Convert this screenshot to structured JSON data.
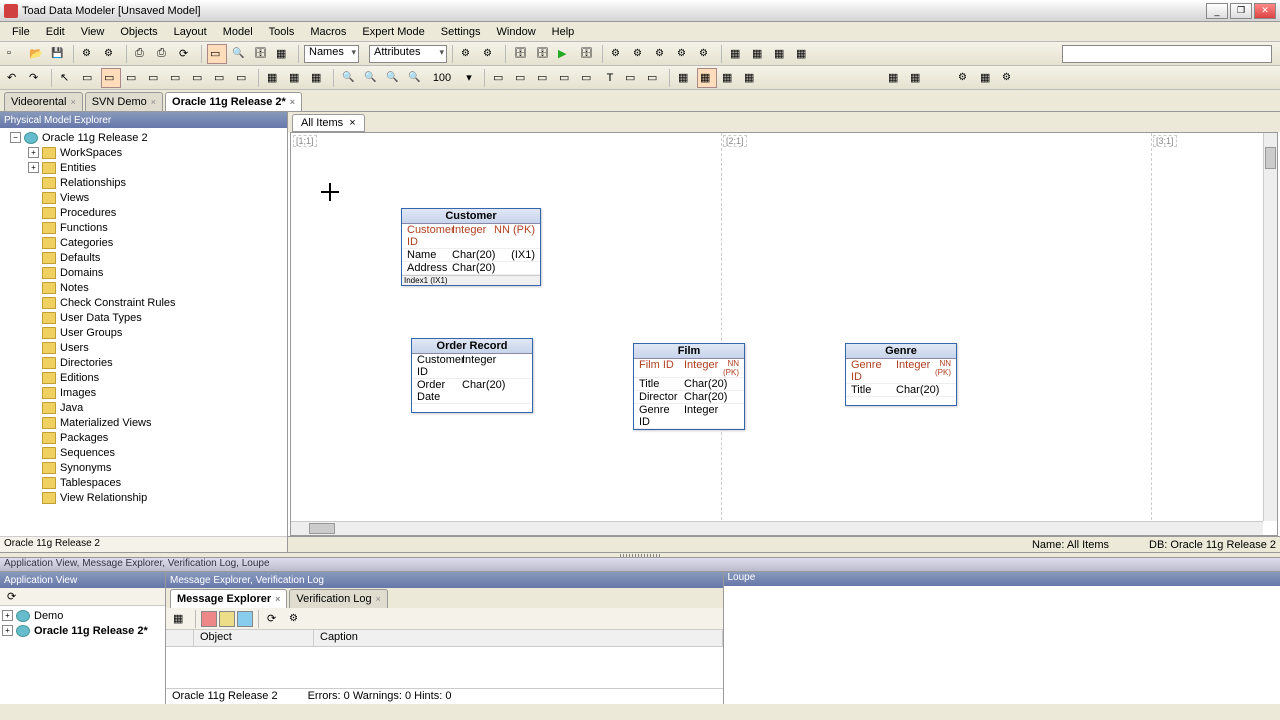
{
  "titlebar": {
    "title": "Toad Data Modeler  [Unsaved Model]"
  },
  "menu": [
    "File",
    "Edit",
    "View",
    "Objects",
    "Layout",
    "Model",
    "Tools",
    "Macros",
    "Expert Mode",
    "Settings",
    "Window",
    "Help"
  ],
  "toolbar1": {
    "combo_names": "Names",
    "combo_attrs": "Attributes"
  },
  "toolbar2": {
    "zoom": "100"
  },
  "doc_tabs": [
    {
      "label": "Videorental",
      "active": false
    },
    {
      "label": "SVN Demo",
      "active": false
    },
    {
      "label": "Oracle 11g Release 2*",
      "active": true
    }
  ],
  "explorer": {
    "header": "Physical Model Explorer",
    "root": "Oracle 11g Release 2",
    "items": [
      "WorkSpaces",
      "Entities",
      "Relationships",
      "Views",
      "Procedures",
      "Functions",
      "Categories",
      "Defaults",
      "Domains",
      "Notes",
      "Check Constraint Rules",
      "User Data Types",
      "User Groups",
      "Users",
      "Directories",
      "Editions",
      "Images",
      "Java",
      "Materialized Views",
      "Packages",
      "Sequences",
      "Synonyms",
      "Tablespaces",
      "View Relationship"
    ],
    "status": "Oracle 11g Release 2"
  },
  "canvas": {
    "tab": "All Items",
    "markers": {
      "p11": "[1;1]",
      "p21": "[2;1]",
      "p31": "[3;1]"
    },
    "status_name": "Name: All Items",
    "status_db": "DB: Oracle 11g Release 2"
  },
  "entities": {
    "customer": {
      "title": "Customer",
      "rows": [
        {
          "name": "Customer ID",
          "type": "Integer",
          "flags": "NN  (PK)",
          "key": true
        },
        {
          "name": "Name",
          "type": "Char(20)",
          "flags": "(IX1)",
          "key": false
        },
        {
          "name": "Address",
          "type": "Char(20)",
          "flags": "",
          "key": false
        }
      ],
      "footer": "Index1 (IX1)"
    },
    "order": {
      "title": "Order Record",
      "rows": [
        {
          "name": "Customer ID",
          "type": "Integer",
          "flags": "",
          "key": false
        },
        {
          "name": "Order Date",
          "type": "Char(20)",
          "flags": "",
          "key": false
        }
      ]
    },
    "film": {
      "title": "Film",
      "rows": [
        {
          "name": "Film ID",
          "type": "Integer",
          "flags": "NN  (PK)",
          "key": true
        },
        {
          "name": "Title",
          "type": "Char(20)",
          "flags": "",
          "key": false
        },
        {
          "name": "Director",
          "type": "Char(20)",
          "flags": "",
          "key": false
        },
        {
          "name": "Genre ID",
          "type": "Integer",
          "flags": "",
          "key": false
        }
      ]
    },
    "genre": {
      "title": "Genre",
      "rows": [
        {
          "name": "Genre ID",
          "type": "Integer",
          "flags": "NN  (PK)",
          "key": true
        },
        {
          "name": "Title",
          "type": "Char(20)",
          "flags": "",
          "key": false
        }
      ]
    }
  },
  "bottom_header": "Application View, Message Explorer, Verification Log, Loupe",
  "app_view": {
    "header": "Application View",
    "items": [
      {
        "label": "Demo",
        "bold": false
      },
      {
        "label": "Oracle 11g Release 2*",
        "bold": true
      }
    ]
  },
  "msg": {
    "header": "Message Explorer, Verification Log",
    "tabs": [
      {
        "label": "Message Explorer",
        "active": true
      },
      {
        "label": "Verification Log",
        "active": false
      }
    ],
    "cols": {
      "object": "Object",
      "caption": "Caption"
    },
    "status_model": "Oracle 11g Release 2",
    "status_counts": "Errors: 0   Warnings: 0   Hints: 0"
  },
  "loupe": {
    "header": "Loupe"
  }
}
